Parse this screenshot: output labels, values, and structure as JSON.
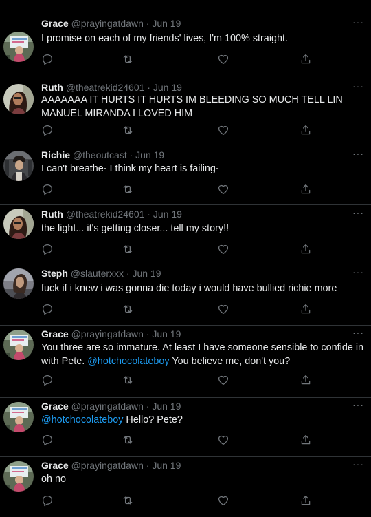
{
  "tweets": [
    {
      "name": "Grace",
      "handle": "@prayingatdawn",
      "date": "Jun 19",
      "avatar": "grace",
      "body": [
        {
          "t": "I promise on each of my friends' lives, I'm 100% straight."
        }
      ]
    },
    {
      "name": "Ruth",
      "handle": "@theatrekid24601",
      "date": "Jun 19",
      "avatar": "ruth",
      "body": [
        {
          "t": "AAAAAAA IT HURTS IT HURTS IM BLEEDING SO MUCH TELL LIN MANUEL MIRANDA I LOVED HIM"
        }
      ]
    },
    {
      "name": "Richie",
      "handle": "@theoutcast",
      "date": "Jun 19",
      "avatar": "richie",
      "body": [
        {
          "t": "I can't breathe- I think my heart is failing-"
        }
      ]
    },
    {
      "name": "Ruth",
      "handle": "@theatrekid24601",
      "date": "Jun 19",
      "avatar": "ruth",
      "body": [
        {
          "t": "the light... it's getting closer... tell my story!!"
        }
      ]
    },
    {
      "name": "Steph",
      "handle": "@slauterxxx",
      "date": "Jun 19",
      "avatar": "steph",
      "body": [
        {
          "t": "fuck if i knew i was gonna die today i would have bullied richie more"
        }
      ]
    },
    {
      "name": "Grace",
      "handle": "@prayingatdawn",
      "date": "Jun 19",
      "avatar": "grace",
      "body": [
        {
          "t": "You three are so immature. At least I have someone sensible to confide in with Pete. "
        },
        {
          "t": "@hotchocolateboy",
          "mention": true
        },
        {
          "t": " You believe me, don't you?"
        }
      ]
    },
    {
      "name": "Grace",
      "handle": "@prayingatdawn",
      "date": "Jun 19",
      "avatar": "grace",
      "body": [
        {
          "t": "@hotchocolateboy",
          "mention": true
        },
        {
          "t": " Hello? Pete?"
        }
      ]
    },
    {
      "name": "Grace",
      "handle": "@prayingatdawn",
      "date": "Jun 19",
      "avatar": "grace",
      "body": [
        {
          "t": "oh no"
        }
      ]
    }
  ],
  "ui": {
    "more_glyph": "···",
    "separator": "·",
    "actions": [
      "reply-icon",
      "retweet-icon",
      "like-icon",
      "share-icon"
    ]
  },
  "colors": {
    "background": "#000000",
    "text": "#e7e9ea",
    "muted": "#71767b",
    "mention": "#1d9bf0",
    "divider": "#2f3336"
  }
}
